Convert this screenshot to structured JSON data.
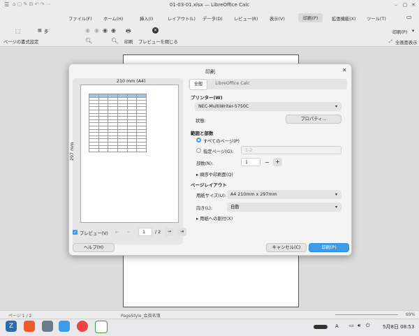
{
  "window": {
    "title": "01-03-01.xlsx — LibreOffice Calc"
  },
  "menu": {
    "items": [
      "ファイル(F)",
      "ホーム(H)",
      "挿入(I)",
      "レイアウト(L)",
      "データ(D)",
      "レビュー(R)",
      "表示(V)",
      "印刷(P)",
      "拡張機能(X)",
      "ツール(T)"
    ],
    "active": "印刷(P)"
  },
  "toolbar": {
    "page_format": "ページの書式設定",
    "multi": "多",
    "print": "印刷",
    "close_preview": "プレビューを閉じる",
    "print_dropdown": "印刷(P)",
    "fullscreen": "全画面表示"
  },
  "dialog": {
    "title": "印刷",
    "preview_width_label": "210 mm (A4)",
    "preview_height_label": "297 mm",
    "preview_checkbox": "プレビュー(V)",
    "page_current": "1",
    "page_total": "/ 2",
    "tabs": [
      "全般",
      "LibreOffice Calc"
    ],
    "printer_section": "プリンター(W)",
    "printer_name": "NEC-MultiWriter-5750C",
    "status_label": "状態:",
    "properties_button": "プロパティ...",
    "range_section": "範囲と部数",
    "all_pages": "すべてのページ(P)",
    "specific_pages": "指定ページ(G):",
    "specific_pages_placeholder": "1-2",
    "copies_label": "部数(N):",
    "copies_value": "1",
    "order_expander": "順序や印刷面(Q)",
    "layout_section": "ページレイアウト",
    "paper_size_label": "用紙サイズ(U):",
    "paper_size_value": "A4 210mm x 297mm",
    "orientation_label": "向き(L):",
    "orientation_value": "自動",
    "fit_expander": "用紙への割付(X)",
    "help_button": "ヘルプ(H)",
    "cancel_button": "キャンセル(C)",
    "print_button": "印刷(P)"
  },
  "statusbar": {
    "page": "ページ 1 / 2",
    "style": "PageStyle_会員名簿",
    "zoom": "69%"
  },
  "taskbar": {
    "clock": "5月8日 08:53",
    "lang": "A"
  },
  "colors": {
    "accent": "#3d9bea",
    "header_blue": "#9ec3e6"
  }
}
